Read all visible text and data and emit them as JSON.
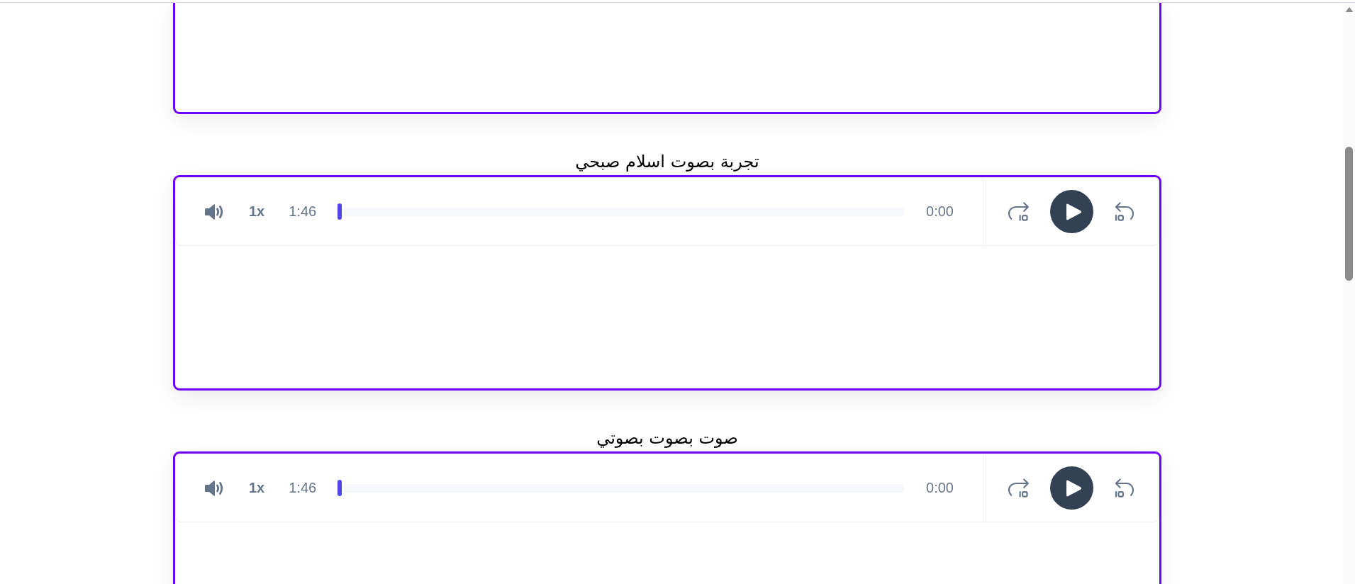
{
  "cards": [
    {
      "kind": "clipped"
    },
    {
      "kind": "player",
      "title": "تجربة بصوت اسلام صبحي",
      "player": {
        "muted": false,
        "speed": "1x",
        "duration": "1:46",
        "progress": {
          "level": 0
        },
        "current_time": "0:00",
        "playing": false
      }
    },
    {
      "kind": "player",
      "title": "صوت بصوت بصوتي",
      "player": {
        "muted": false,
        "speed": "1x",
        "duration": "1:46",
        "progress": {
          "level": 0
        },
        "current_time": "0:00",
        "playing": false
      }
    }
  ]
}
